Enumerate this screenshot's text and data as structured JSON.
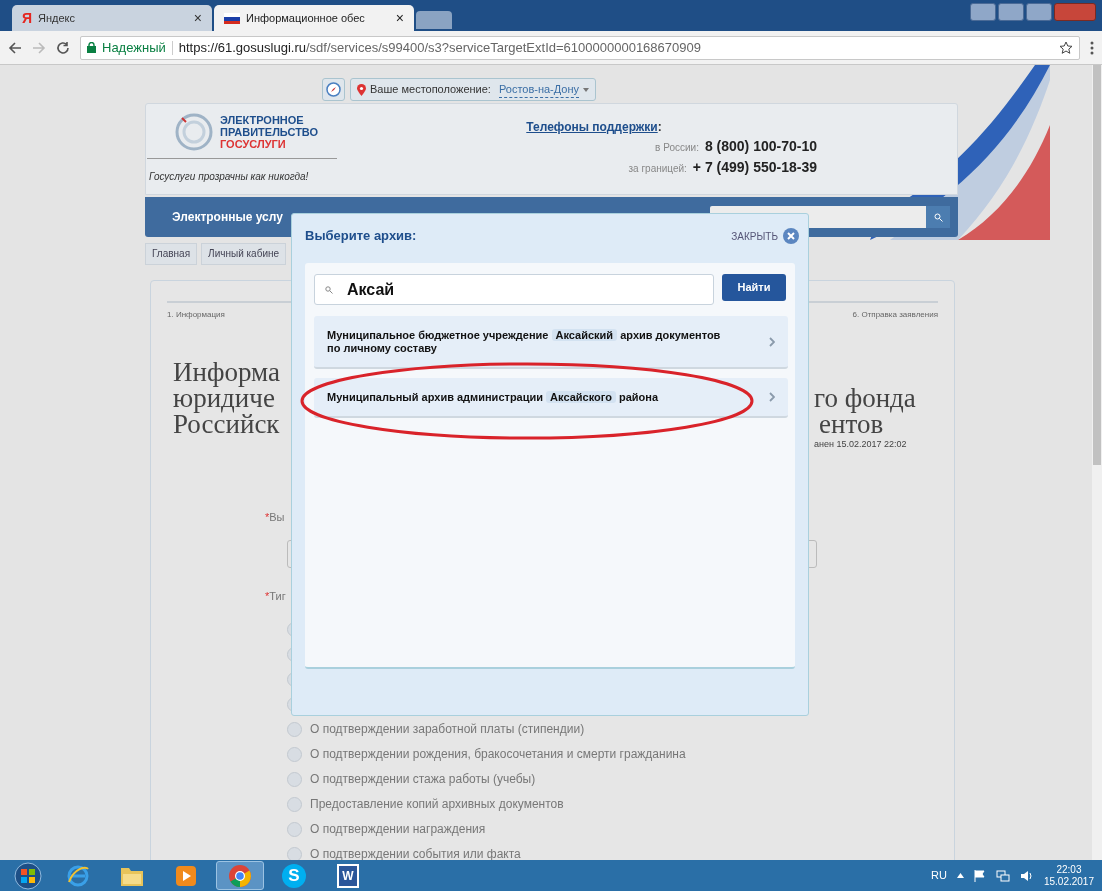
{
  "browser": {
    "tabs": [
      {
        "label": "Яндекс",
        "favicon": "Я",
        "selected": false
      },
      {
        "label": "Информационное обес",
        "selected": true
      }
    ],
    "tab_close": "×",
    "secure_label": "Надежный",
    "url_host": "https://61.gosuslugi.ru",
    "url_path": "/sdf/services/s99400/s3?serviceTargetExtId=6100000000168670909"
  },
  "location": {
    "label": "Ваше местоположение:",
    "value": "Ростов-на-Дону"
  },
  "header": {
    "logo_lines": [
      "ЭЛЕКТРОННОЕ",
      "ПРАВИТЕЛЬСТВО",
      "ГОСУСЛУГИ"
    ],
    "tagline": "Госуслуги прозрачны как никогда!",
    "support_title": "Телефоны поддержки",
    "support_colon": ":",
    "phones": [
      {
        "label": "в России:",
        "number": "8 (800) 100-70-10"
      },
      {
        "label": "за границей:",
        "number": "+ 7 (499) 550-18-39"
      }
    ]
  },
  "nav": {
    "items": [
      "Электронные услу"
    ]
  },
  "breadcrumbs": [
    "Главная",
    "Личный кабине"
  ],
  "steps": [
    "1. Информация",
    "6. Отправка заявления"
  ],
  "page_title": {
    "left_lines": [
      "Информа",
      "юридиче",
      "Российск"
    ],
    "right_lines": [
      "го фонда",
      "ентов"
    ],
    "saved": "анен 15.02.2017 22:02"
  },
  "fields": [
    {
      "mark": "*",
      "label": "Вы"
    },
    {
      "mark": "*",
      "label": "Тиг"
    }
  ],
  "options": [
    {
      "selected": false
    },
    {
      "selected": false
    },
    {
      "selected": false
    },
    {
      "selected": false
    },
    {
      "label": "О подтверждении заработной платы (стипендии)",
      "selected": false
    },
    {
      "label": "О подтверждении рождения, бракосочетания и смерти гражданина",
      "selected": false
    },
    {
      "label": "О подтверждении стажа работы (учебы)",
      "selected": false
    },
    {
      "label": "Предоставление копий архивных документов",
      "selected": false
    },
    {
      "label": "О подтверждении награждения",
      "selected": false
    },
    {
      "label": "О подтверждении события или факта",
      "selected": false
    }
  ],
  "modal": {
    "title": "Выберите архив:",
    "close_label": "ЗАКРЫТЬ",
    "search_value": "Аксай",
    "search_button": "Найти",
    "results": [
      {
        "segments": [
          {
            "text": "Муниципальное бюджетное учреждение",
            "highlight": false
          },
          {
            "text": "Аксайский",
            "highlight": true
          },
          {
            "text": "архив документов по личному составу",
            "highlight": false
          }
        ]
      },
      {
        "segments": [
          {
            "text": "Муниципальный архив администрации",
            "highlight": false
          },
          {
            "text": "Аксайского",
            "highlight": true
          },
          {
            "text": "района",
            "highlight": false
          }
        ]
      }
    ]
  },
  "annotation": {
    "kind": "ellipse",
    "color": "#d9232a"
  },
  "taskbar": {
    "apps": [
      {
        "kind": "ie"
      },
      {
        "kind": "folder"
      },
      {
        "kind": "player"
      },
      {
        "kind": "chrome",
        "selected": true
      },
      {
        "kind": "skype",
        "glyph": "S"
      },
      {
        "kind": "word",
        "glyph": "W"
      }
    ],
    "language": "RU",
    "time": "22:03",
    "date": "15.02.2017"
  }
}
